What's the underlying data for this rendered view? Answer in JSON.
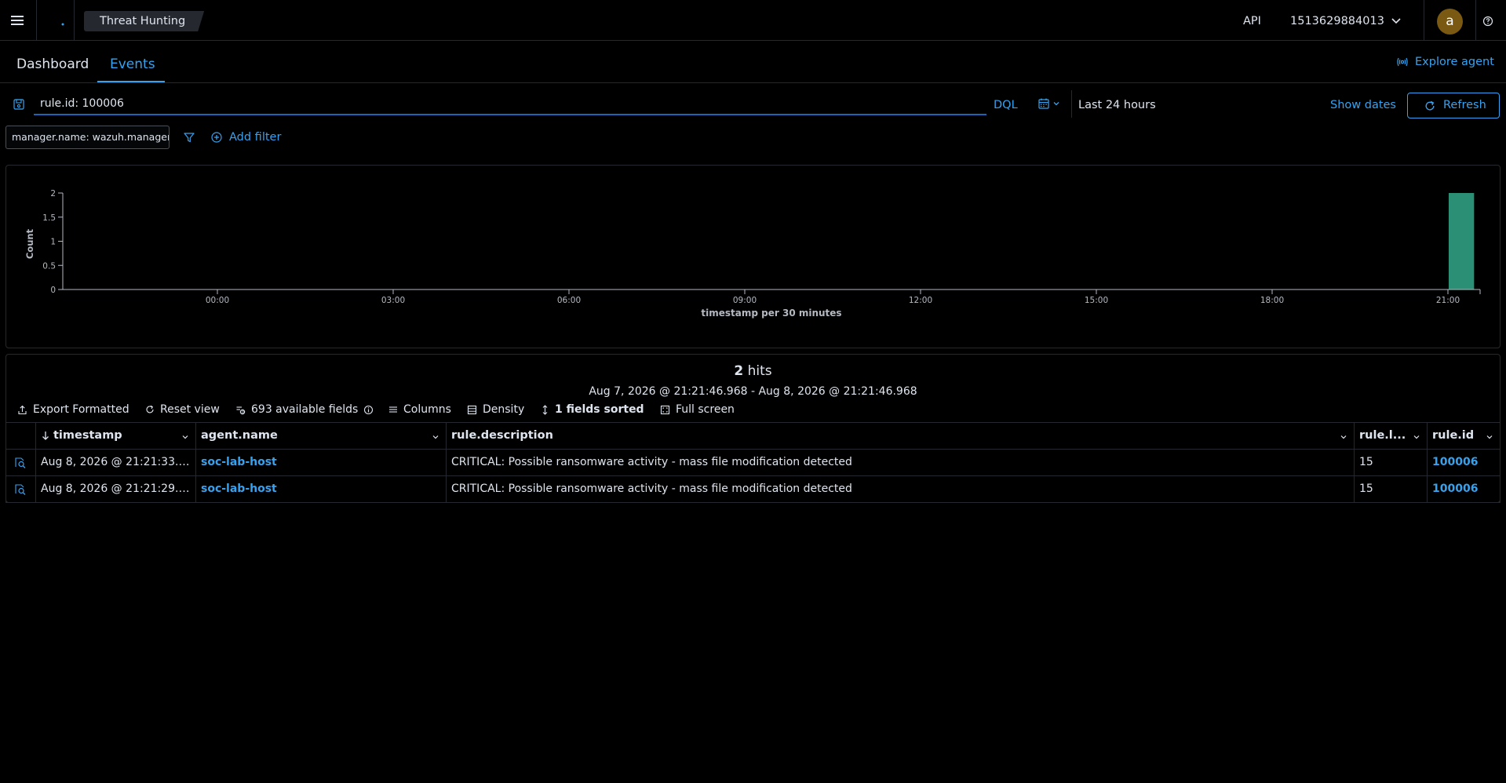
{
  "header": {
    "breadcrumb": "Threat Hunting",
    "api_label": "API",
    "api_id": "1513629884013",
    "avatar_initial": "a"
  },
  "tabs": [
    {
      "label": "Dashboard",
      "active": false
    },
    {
      "label": "Events",
      "active": true
    }
  ],
  "explore_agent": "Explore agent",
  "query": {
    "value": "rule.id: 100006",
    "language": "DQL",
    "time_range": "Last 24 hours",
    "show_dates": "Show dates",
    "refresh": "Refresh"
  },
  "filters": {
    "pills": [
      "manager.name: wazuh.manager"
    ],
    "add_filter": "Add filter"
  },
  "chart_data": {
    "type": "bar",
    "xlabel": "timestamp per 30 minutes",
    "ylabel": "Count",
    "x_ticks": [
      "00:00",
      "03:00",
      "06:00",
      "09:00",
      "12:00",
      "15:00",
      "18:00",
      "21:00"
    ],
    "y_ticks": [
      "0",
      "0.5",
      "1",
      "1.5",
      "2"
    ],
    "ylim": [
      0,
      2
    ],
    "bars": [
      {
        "bucket_start": "21:00",
        "value": 2
      }
    ],
    "bar_color": "#2a8f74",
    "grid": false
  },
  "hits": {
    "count": "2",
    "label": "hits",
    "range": "Aug 7, 2026 @ 21:21:46.968 - Aug 8, 2026 @ 21:21:46.968"
  },
  "toolbar": {
    "export": "Export Formatted",
    "reset": "Reset view",
    "fields": "693 available fields",
    "columns": "Columns",
    "density": "Density",
    "sorted": "1 fields sorted",
    "fullscreen": "Full screen"
  },
  "table": {
    "columns": [
      "timestamp",
      "agent.name",
      "rule.description",
      "rule.l...",
      "rule.id"
    ],
    "rows": [
      {
        "timestamp": "Aug 8, 2026 @ 21:21:33.…",
        "agent": "soc-lab-host",
        "description": "CRITICAL: Possible ransomware activity - mass file modification detected",
        "level": "15",
        "rule_id": "100006"
      },
      {
        "timestamp": "Aug 8, 2026 @ 21:21:29.…",
        "agent": "soc-lab-host",
        "description": "CRITICAL: Possible ransomware activity - mass file modification detected",
        "level": "15",
        "rule_id": "100006"
      }
    ]
  },
  "colors": {
    "accent": "#36a2ef",
    "background": "#000000",
    "border": "#25282f",
    "bar": "#2a8f74"
  }
}
